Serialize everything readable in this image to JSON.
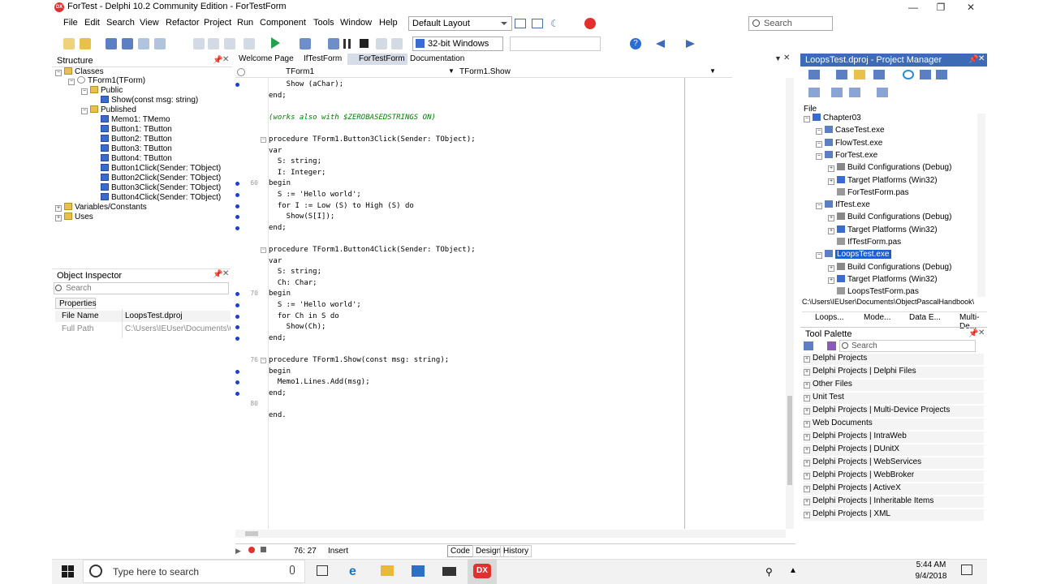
{
  "window": {
    "title": "ForTest - Delphi 10.2 Community Edition - ForTestForm",
    "logo_text": "DX",
    "minimize": "—",
    "maximize": "❐",
    "close": "✕"
  },
  "menu": [
    "File",
    "Edit",
    "Search",
    "View",
    "Refactor",
    "Project",
    "Run",
    "Component",
    "Tools",
    "Window",
    "Help"
  ],
  "layout_select": "Default Layout",
  "top_search": "Search",
  "platform_select": "32-bit Windows",
  "structure": {
    "title": "Structure",
    "tree": [
      {
        "label": "Classes",
        "level": 0,
        "icon": "folder"
      },
      {
        "label": "TForm1(TForm)",
        "level": 1,
        "icon": "gear"
      },
      {
        "label": "Public",
        "level": 2,
        "icon": "folder"
      },
      {
        "label": "Show(const msg: string)",
        "level": 3,
        "icon": "blue"
      },
      {
        "label": "Published",
        "level": 2,
        "icon": "folder"
      },
      {
        "label": "Memo1: TMemo",
        "level": 3,
        "icon": "blue"
      },
      {
        "label": "Button1: TButton",
        "level": 3,
        "icon": "blue"
      },
      {
        "label": "Button2: TButton",
        "level": 3,
        "icon": "blue"
      },
      {
        "label": "Button3: TButton",
        "level": 3,
        "icon": "blue"
      },
      {
        "label": "Button4: TButton",
        "level": 3,
        "icon": "blue"
      },
      {
        "label": "Button1Click(Sender: TObject)",
        "level": 3,
        "icon": "blue"
      },
      {
        "label": "Button2Click(Sender: TObject)",
        "level": 3,
        "icon": "blue"
      },
      {
        "label": "Button3Click(Sender: TObject)",
        "level": 3,
        "icon": "blue"
      },
      {
        "label": "Button4Click(Sender: TObject)",
        "level": 3,
        "icon": "blue"
      },
      {
        "label": "Variables/Constants",
        "level": 0,
        "icon": "folder"
      },
      {
        "label": "Uses",
        "level": 0,
        "icon": "folder"
      }
    ]
  },
  "object_inspector": {
    "title": "Object Inspector",
    "search_placeholder": "Search",
    "tab": "Properties",
    "rows": [
      {
        "name": "File Name",
        "value": "LoopsTest.dproj"
      },
      {
        "name": "Full Path",
        "value": "C:\\Users\\IEUser\\Documents\\C"
      }
    ]
  },
  "editor": {
    "tabs": [
      "Welcome Page",
      "IfTestForm",
      "ForTestForm",
      "Documentation"
    ],
    "active_tab": "ForTestForm",
    "nav_left": "TForm1",
    "nav_right": "TForm1.Show",
    "lines": [
      {
        "text": "    Show (aChar);",
        "bp": true
      },
      {
        "text": "end;",
        "bp": false
      },
      {
        "text": "",
        "bp": false
      },
      {
        "text": "(works also with $ZEROBASEDSTRINGS ON)",
        "bp": false,
        "comment": true
      },
      {
        "text": "",
        "bp": false
      },
      {
        "text": "procedure TForm1.Button3Click(Sender: TObject);",
        "bp": false,
        "fold": true
      },
      {
        "text": "var",
        "bp": false
      },
      {
        "text": "  S: string;",
        "bp": false
      },
      {
        "text": "  I: Integer;",
        "bp": false
      },
      {
        "text": "begin",
        "bp": true,
        "num": "60"
      },
      {
        "text": "  S := 'Hello world';",
        "bp": true
      },
      {
        "text": "  for I := Low (S) to High (S) do",
        "bp": true
      },
      {
        "text": "    Show(S[I]);",
        "bp": true
      },
      {
        "text": "end;",
        "bp": true
      },
      {
        "text": "",
        "bp": false
      },
      {
        "text": "procedure TForm1.Button4Click(Sender: TObject);",
        "bp": false,
        "fold": true
      },
      {
        "text": "var",
        "bp": false
      },
      {
        "text": "  S: string;",
        "bp": false
      },
      {
        "text": "  Ch: Char;",
        "bp": false
      },
      {
        "text": "begin",
        "bp": true,
        "num": "70"
      },
      {
        "text": "  S := 'Hello world';",
        "bp": true
      },
      {
        "text": "  for Ch in S do",
        "bp": true
      },
      {
        "text": "    Show(Ch);",
        "bp": true
      },
      {
        "text": "end;",
        "bp": true
      },
      {
        "text": "",
        "bp": false
      },
      {
        "text": "procedure TForm1.Show(const msg: string);",
        "bp": false,
        "fold": true,
        "num": "76"
      },
      {
        "text": "begin",
        "bp": true
      },
      {
        "text": "  Memo1.Lines.Add(msg);",
        "bp": true
      },
      {
        "text": "end;",
        "bp": true
      },
      {
        "text": "",
        "bp": false,
        "num": "80"
      },
      {
        "text": "end.",
        "bp": false
      }
    ],
    "status": {
      "position": "76: 27",
      "mode": "Insert",
      "tabs": [
        "Code",
        "Design",
        "History"
      ],
      "active": "Code"
    }
  },
  "project_manager": {
    "title": "LoopsTest.dproj - Project Manager",
    "file_label": "File",
    "tree": [
      {
        "label": "Chapter03",
        "level": 0,
        "kind": "group"
      },
      {
        "label": "CaseTest.exe",
        "level": 1,
        "kind": "exe"
      },
      {
        "label": "FlowTest.exe",
        "level": 1,
        "kind": "exe"
      },
      {
        "label": "ForTest.exe",
        "level": 1,
        "kind": "exe"
      },
      {
        "label": "Build Configurations (Debug)",
        "level": 2,
        "kind": "gear"
      },
      {
        "label": "Target Platforms (Win32)",
        "level": 2,
        "kind": "plat"
      },
      {
        "label": "ForTestForm.pas",
        "level": 2,
        "kind": "pas"
      },
      {
        "label": "IfTest.exe",
        "level": 1,
        "kind": "exe"
      },
      {
        "label": "Build Configurations (Debug)",
        "level": 2,
        "kind": "gear"
      },
      {
        "label": "Target Platforms (Win32)",
        "level": 2,
        "kind": "plat"
      },
      {
        "label": "IfTestForm.pas",
        "level": 2,
        "kind": "pas"
      },
      {
        "label": "LoopsTest.exe",
        "level": 1,
        "kind": "exe",
        "selected": true
      },
      {
        "label": "Build Configurations (Debug)",
        "level": 2,
        "kind": "gear"
      },
      {
        "label": "Target Platforms (Win32)",
        "level": 2,
        "kind": "plat"
      },
      {
        "label": "LoopsTestForm.pas",
        "level": 2,
        "kind": "pas"
      }
    ],
    "path": "C:\\Users\\IEUser\\Documents\\ObjectPascalHandbook\\",
    "bottom_tabs": [
      "Loops...",
      "Mode...",
      "Data E...",
      "Multi-De..."
    ]
  },
  "tool_palette": {
    "title": "Tool Palette",
    "search_placeholder": "Search",
    "categories": [
      "Delphi Projects",
      "Delphi Projects | Delphi Files",
      "Other Files",
      "Unit Test",
      "Delphi Projects | Multi-Device Projects",
      "Web Documents",
      "Delphi Projects | IntraWeb",
      "Delphi Projects | DUnitX",
      "Delphi Projects | WebServices",
      "Delphi Projects | WebBroker",
      "Delphi Projects | ActiveX",
      "Delphi Projects | Inheritable Items",
      "Delphi Projects | XML"
    ]
  },
  "taskbar": {
    "search_placeholder": "Type here to search",
    "time": "5:44 AM",
    "date": "9/4/2018"
  }
}
